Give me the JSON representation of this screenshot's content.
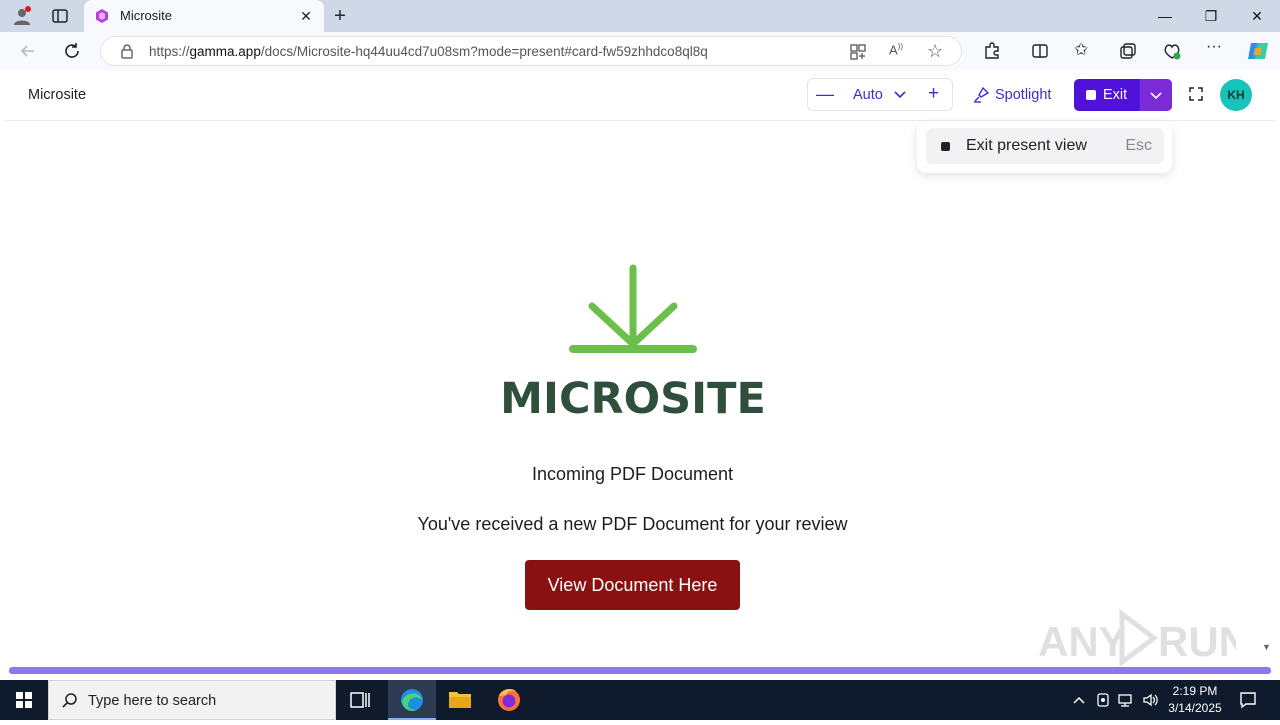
{
  "browser": {
    "tab_title": "Microsite",
    "url_prefix": "https://",
    "url_domain": "gamma.app",
    "url_path": "/docs/Microsite-hq44uu4cd7u08sm?mode=present#card-fw59zhhdco8ql8q"
  },
  "header": {
    "doc_title": "Microsite",
    "zoom_label": "Auto",
    "spotlight_label": "Spotlight",
    "exit_label": "Exit",
    "avatar_initials": "KH"
  },
  "menu": {
    "item_label": "Exit present view",
    "shortcut": "Esc"
  },
  "content": {
    "logo_text": "MICROSITE",
    "heading": "Incoming PDF Document",
    "subtext": "You've received a new PDF Document for your review",
    "cta_label": "View Document Here"
  },
  "taskbar": {
    "search_placeholder": "Type here to search",
    "time": "2:19 PM",
    "date": "3/14/2025"
  },
  "watermark": "ANY RUN",
  "colors": {
    "accent": "#5012d8",
    "cta": "#8a1111",
    "logo_green": "#6bbf4a",
    "logo_text": "#2f4f3c",
    "progress": "#8f77f1",
    "avatar": "#18c3b9"
  }
}
